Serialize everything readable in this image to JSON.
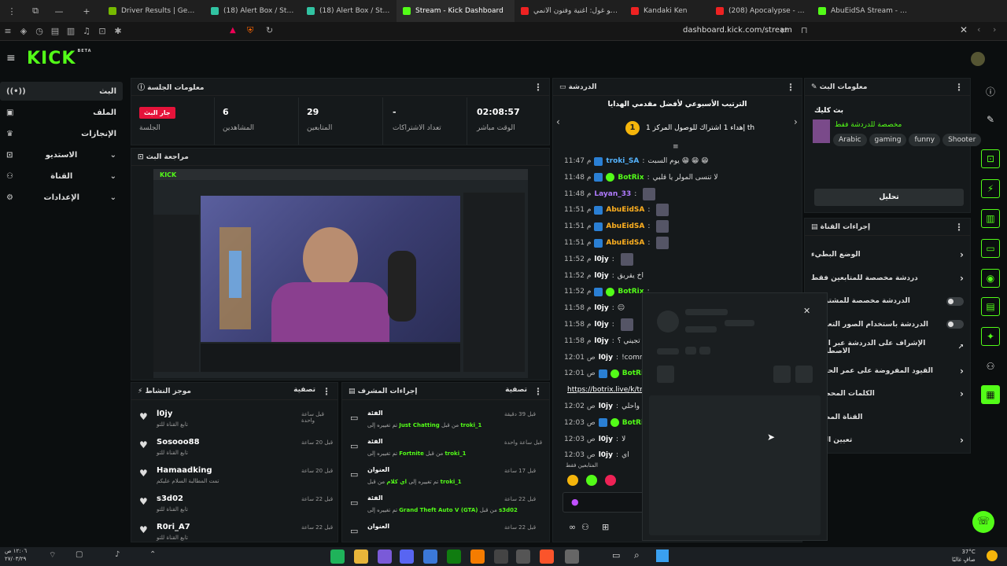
{
  "browser": {
    "tabs": [
      {
        "label": "Driver Results | GeForce RTX 30",
        "color": "#76b900"
      },
      {
        "label": "(18) Alert Box / Streamlabs",
        "color": "#31c3a2"
      },
      {
        "label": "(18) Alert Box / Streamlabs",
        "color": "#31c3a2"
      },
      {
        "label": "Stream - Kick Dashboard",
        "color": "#53fc18"
      },
      {
        "label": "طوكيو غول: أغنية وفنون الأنمي",
        "color": "#e22"
      },
      {
        "label": "Kandaki Ken",
        "color": "#e22"
      },
      {
        "label": "(208) Apocalypse - YouTub",
        "color": "#e22"
      },
      {
        "label": "AbuEidSA Stream - Watch Live",
        "color": "#53fc18"
      }
    ],
    "url": "dashboard.kick.com/stream"
  },
  "brand": {
    "logo": "KICK",
    "beta": "BETA"
  },
  "sidebar": {
    "items": [
      {
        "label": "البث",
        "icon": "live-icon"
      },
      {
        "label": "الملف",
        "icon": "profile-icon"
      },
      {
        "label": "الإنجازات",
        "icon": "achievements-icon"
      },
      {
        "label": "الاستديو",
        "icon": "studio-icon"
      },
      {
        "label": "القناة",
        "icon": "channel-icon"
      },
      {
        "label": "الإعدادات",
        "icon": "settings-icon"
      }
    ]
  },
  "session": {
    "title": "معلومات الجلسة",
    "live_badge": "جار البث",
    "session_label": "الجلسة",
    "viewers_value": "6",
    "viewers_label": "المشاهدين",
    "followers_value": "29",
    "followers_label": "المتابعين",
    "subs_value": "-",
    "subs_label": "تعداد الاشتراكات",
    "time_value": "02:08:57",
    "time_label": "الوقت مباشر"
  },
  "preview": {
    "title": "مراجعة البث"
  },
  "activity": {
    "title": "موجز النشاط",
    "filter": "تصفية",
    "items": [
      {
        "name": "l0jy",
        "sub": "تابع القناة للتو",
        "time": "قبل ساعة واحدة"
      },
      {
        "name": "Sosooo88",
        "sub": "تابع القناة للتو",
        "time": "قبل 20 ساعة"
      },
      {
        "name": "Hamaadking",
        "sub": "تمت المطالبة السلام عليكم",
        "time": "قبل 20 ساعة"
      },
      {
        "name": "s3d02",
        "sub": "تابع القناة للتو",
        "time": "قبل 22 ساعة"
      },
      {
        "name": "R0ri_A7",
        "sub": "تابع القناة للتو",
        "time": "قبل 22 ساعة"
      }
    ]
  },
  "modactions": {
    "title": "إجراءات المشرف",
    "filter": "تصفية",
    "items": [
      {
        "head": "الفئة",
        "pre": "تم تغييره إلى",
        "value": "Just Chatting",
        "mid": "من قبل",
        "user": "troki_1",
        "time": "قبل 39 دقيقة"
      },
      {
        "head": "الفئة",
        "pre": "تم تغييره إلى",
        "value": "Fortnite",
        "mid": "من قبل",
        "user": "troki_1",
        "time": "قبل ساعة واحدة"
      },
      {
        "head": "العنوان",
        "pre": "تم تغييره إلى",
        "value": "اي كلام",
        "mid": "من قبل",
        "user": "troki_1",
        "time": "قبل 17 ساعة"
      },
      {
        "head": "الفئة",
        "pre": "تم تغييره إلى",
        "value": "Grand Theft Auto V (GTA)",
        "mid": "من قبل",
        "user": "s3d02",
        "time": "قبل 22 ساعة"
      },
      {
        "head": "العنوان",
        "pre": "",
        "value": "",
        "mid": "",
        "user": "",
        "time": "قبل 22 ساعة"
      }
    ]
  },
  "chat": {
    "title": "الدردشة",
    "leaderboard_title": "الترتيب الأسبوعي لأفضل مقدمي الهدايا",
    "leaderboard_line": "إهداء 1 اشتراك للوصول المركز 1 th",
    "rank": "1",
    "messages": [
      {
        "time": "11:47 م",
        "user": "troki_SA",
        "cls": "u-blue",
        "text": "يوم السبت 😁 😁 😁"
      },
      {
        "time": "11:48 م",
        "user": "BotRix",
        "cls": "u-green",
        "text": "لا تنسى المولر يا قلبي"
      },
      {
        "time": "11:48 م",
        "user": "Layan_33",
        "cls": "u-purple",
        "text": ""
      },
      {
        "time": "11:51 م",
        "user": "AbuEidSA",
        "cls": "u-orange",
        "text": ""
      },
      {
        "time": "11:51 م",
        "user": "AbuEidSA",
        "cls": "u-orange",
        "text": ""
      },
      {
        "time": "11:51 م",
        "user": "AbuEidSA",
        "cls": "u-orange",
        "text": ""
      },
      {
        "time": "11:52 م",
        "user": "l0jy",
        "cls": "u-white",
        "text": ""
      },
      {
        "time": "11:52 م",
        "user": "l0jy",
        "cls": "u-white",
        "text": "اخ يقريق"
      },
      {
        "time": "11:52 م",
        "user": "BotRix",
        "cls": "u-green",
        "text": ""
      },
      {
        "time": "11:58 م",
        "user": "l0jy",
        "cls": "u-white",
        "text": "😐"
      },
      {
        "time": "11:58 م",
        "user": "l0jy",
        "cls": "u-white",
        "text": ""
      },
      {
        "time": "11:58 م",
        "user": "l0jy",
        "cls": "u-white",
        "text": "وش يعني تجيني ولا تجيني ؟"
      },
      {
        "time": "12:01 ص",
        "user": "l0jy",
        "cls": "u-white",
        "text": "!commands"
      },
      {
        "time": "12:01 ص",
        "user": "BotRix",
        "cls": "u-green",
        "text": "تا"
      },
      {
        "time": "",
        "user": "",
        "cls": "u-white",
        "text": "https://botrix.live/k/trok"
      },
      {
        "time": "12:02 ص",
        "user": "l0jy",
        "cls": "u-white",
        "text": "وك مرا واحلي"
      },
      {
        "time": "12:03 ص",
        "user": "BotRix",
        "cls": "u-green",
        "text": ""
      },
      {
        "time": "12:03 ص",
        "user": "l0jy",
        "cls": "u-white",
        "text": "لا"
      },
      {
        "time": "12:03 ص",
        "user": "l0jy",
        "cls": "u-white",
        "text": "اي"
      }
    ],
    "followers_only": "المتابعين فقط"
  },
  "streaminfo": {
    "title": "معلومات البث",
    "stream_title": "بث كليك",
    "category": "مخصصة للدردشة فقط",
    "tags": [
      "Arabic",
      "gaming",
      "funny",
      "Shooter"
    ],
    "edit_button": "تحليل"
  },
  "channelactions": {
    "title": "إجراءات القناة",
    "items": [
      {
        "label": "الوضع البطيء",
        "ctrl": "arrow"
      },
      {
        "label": "دردشة مخصصة للمتابعين فقط",
        "ctrl": "arrow"
      },
      {
        "label": "الدردشة مخصصة للمشتركين",
        "ctrl": "toggle"
      },
      {
        "label": "الدردشة باستخدام الصور التعبيرية",
        "ctrl": "toggle"
      },
      {
        "label": "الإشراف على الدردشة عبر الذكاء الاصطناعي",
        "ctrl": "link"
      },
      {
        "label": "القيود المفروضة على عمر الحساب",
        "ctrl": "arrow"
      },
      {
        "label": "الكلمات المحظورة",
        "ctrl": "arrow"
      },
      {
        "label": "القناة المضيفة",
        "ctrl": "none"
      },
      {
        "label": "تعيين الحالة",
        "ctrl": "arrow"
      }
    ]
  },
  "taskbar": {
    "time": "١٢:٠٦ ص",
    "date": "٢٧/٠٣/٢٩",
    "weather_temp": "37°C",
    "weather_desc": "صافٍ غالبًا"
  }
}
